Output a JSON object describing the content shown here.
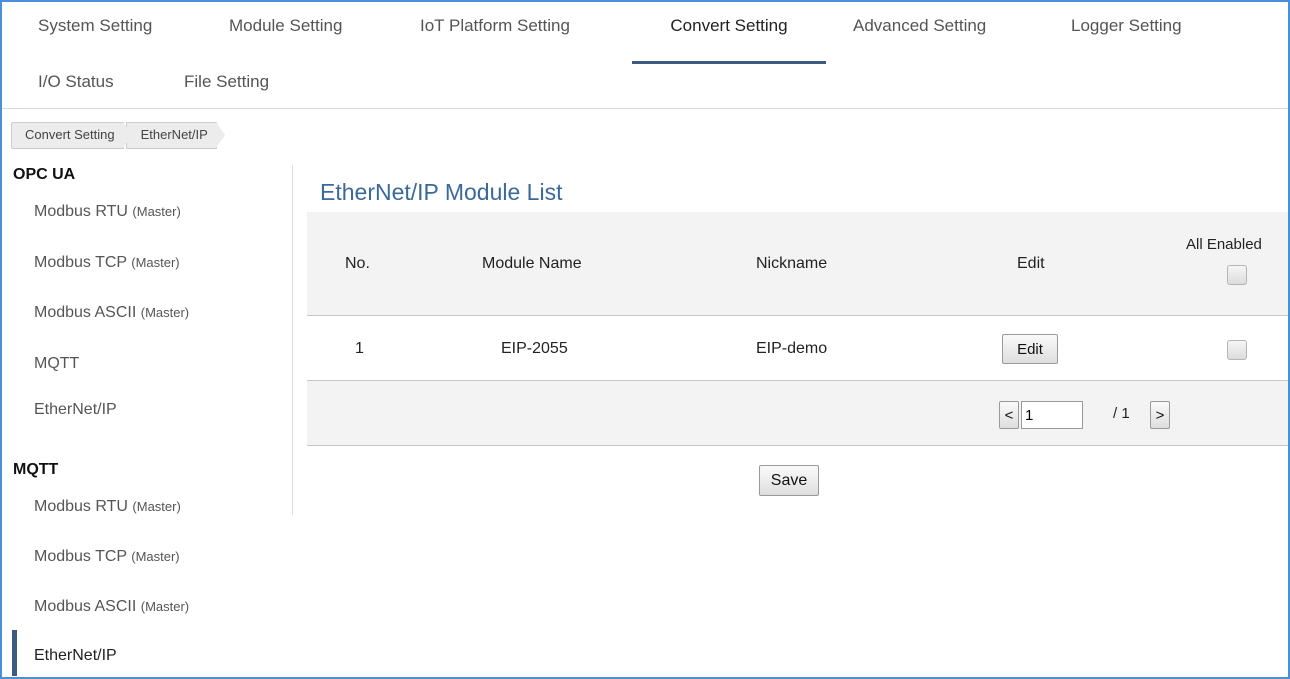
{
  "nav": {
    "tabs": [
      {
        "label": "System Setting"
      },
      {
        "label": "Module Setting"
      },
      {
        "label": "IoT Platform Setting"
      },
      {
        "label": "Convert Setting",
        "active": true
      },
      {
        "label": "Advanced Setting"
      },
      {
        "label": "Logger Setting"
      },
      {
        "label": "I/O Status"
      },
      {
        "label": "File Setting"
      }
    ],
    "active_color": "#3d5a80"
  },
  "breadcrumb": [
    "Convert Setting",
    "EtherNet/IP"
  ],
  "sidebar": {
    "groups": [
      {
        "title": "OPC UA",
        "items": [
          {
            "label": "Modbus RTU",
            "sub": "(Master)"
          },
          {
            "label": "Modbus TCP",
            "sub": "(Master)"
          },
          {
            "label": "Modbus ASCII",
            "sub": "(Master)"
          },
          {
            "label": "MQTT",
            "sub": ""
          },
          {
            "label": "EtherNet/IP",
            "sub": ""
          }
        ]
      },
      {
        "title": "MQTT",
        "items": [
          {
            "label": "Modbus RTU",
            "sub": "(Master)"
          },
          {
            "label": "Modbus TCP",
            "sub": "(Master)"
          },
          {
            "label": "Modbus ASCII",
            "sub": "(Master)"
          },
          {
            "label": "EtherNet/IP",
            "sub": "",
            "active": true
          }
        ]
      }
    ]
  },
  "main": {
    "title": "EtherNet/IP Module List",
    "table": {
      "headers": {
        "no": "No.",
        "module_name": "Module Name",
        "nickname": "Nickname",
        "edit": "Edit",
        "all_enabled": "All Enabled"
      },
      "rows": [
        {
          "no": "1",
          "module_name": "EIP-2055",
          "nickname": "EIP-demo",
          "edit_label": "Edit",
          "enabled": false
        }
      ]
    },
    "pager": {
      "prev": "<",
      "next": ">",
      "current": "1",
      "total": "/ 1"
    },
    "save_label": "Save"
  }
}
